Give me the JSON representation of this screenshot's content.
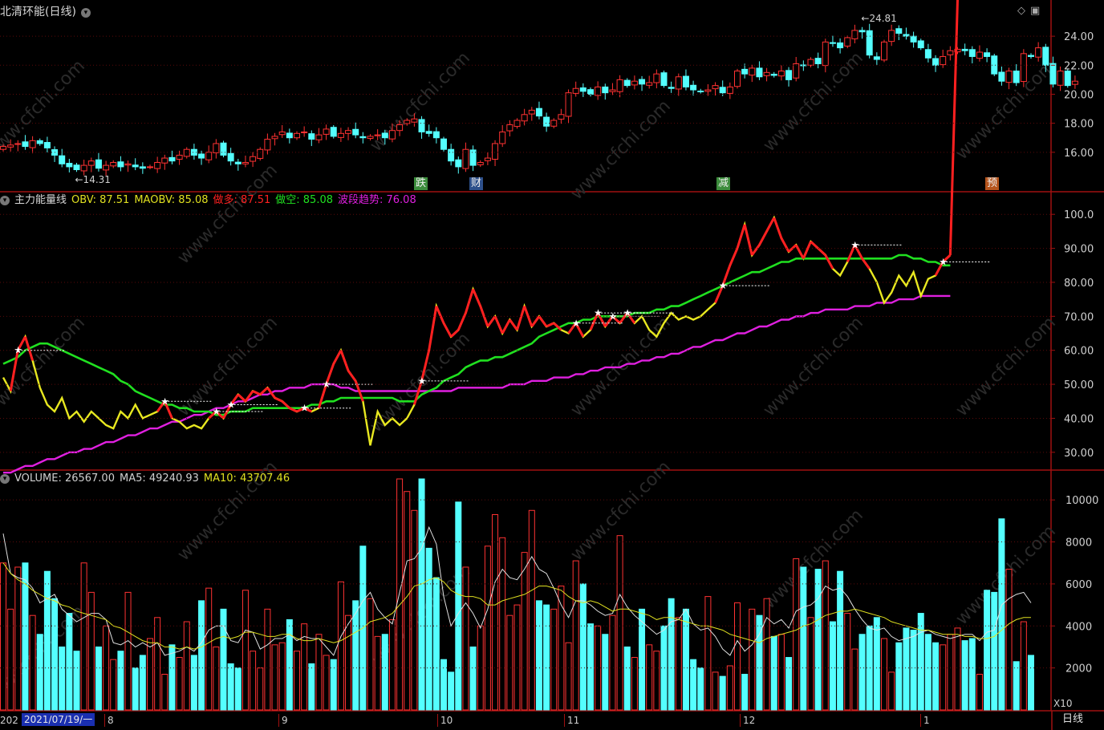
{
  "stock": {
    "title": "北清环能(日线)"
  },
  "price_axis": {
    "ticks": [
      "24.00",
      "22.00",
      "20.00",
      "18.00",
      "16.00"
    ]
  },
  "annotations": {
    "low_label": "14.31",
    "high_label": "24.81"
  },
  "event_tags": [
    {
      "label": "跌",
      "color": "#3c8c3c"
    },
    {
      "label": "财",
      "color": "#2d4f8a"
    },
    {
      "label": "减",
      "color": "#3c8c3c"
    },
    {
      "label": "预",
      "color": "#b5541c"
    }
  ],
  "indicator": {
    "name": "主力能量线",
    "fields": [
      {
        "text": "OBV: 87.51",
        "color": "#e0e020"
      },
      {
        "text": "MAOBV: 85.08",
        "color": "#e0e020"
      },
      {
        "text": "做多: 87.51",
        "color": "#ff2020"
      },
      {
        "text": "做空: 85.08",
        "color": "#20e020"
      },
      {
        "text": "波段趋势: 76.08",
        "color": "#e020e0"
      }
    ],
    "axis_ticks": [
      "100.0",
      "90.00",
      "80.00",
      "70.00",
      "60.00",
      "50.00",
      "40.00",
      "30.00"
    ]
  },
  "volume": {
    "fields": [
      {
        "text": "VOLUME: 26567.00",
        "color": "#d0d0d0"
      },
      {
        "text": "MA5: 49240.93",
        "color": "#d0d0d0"
      },
      {
        "text": "MA10: 43707.46",
        "color": "#e0e020"
      }
    ],
    "axis_ticks": [
      "10000",
      "8000",
      "6000",
      "4000",
      "2000"
    ],
    "unit": "X10"
  },
  "date_axis": {
    "current": "2021/07/19/一",
    "prefix": "202",
    "months": [
      "8",
      "9",
      "10",
      "11",
      "12",
      "1"
    ]
  },
  "period_button": "日线",
  "watermark": "www.cfchi.com",
  "chart_data": [
    {
      "type": "candlestick",
      "title": "北清环能(日线)",
      "ylim": [
        14.0,
        25.5
      ],
      "close": [
        16.4,
        16.5,
        16.6,
        16.4,
        16.8,
        16.6,
        16.3,
        15.8,
        15.2,
        15.0,
        14.8,
        15.1,
        15.4,
        14.9,
        15.1,
        15.3,
        15.0,
        15.2,
        15.0,
        14.9,
        15.0,
        15.3,
        15.6,
        15.4,
        15.8,
        16.2,
        15.8,
        15.6,
        16.0,
        16.6,
        15.8,
        15.4,
        15.2,
        15.3,
        15.7,
        16.2,
        16.9,
        17.1,
        17.4,
        17.0,
        17.3,
        17.4,
        16.9,
        17.2,
        17.6,
        17.1,
        17.3,
        17.5,
        17.2,
        17.0,
        17.1,
        17.2,
        17.0,
        17.5,
        17.9,
        18.2,
        18.3,
        17.4,
        17.3,
        17.0,
        16.2,
        15.4,
        15.0,
        16.2,
        15.1,
        15.3,
        15.6,
        16.6,
        17.4,
        17.9,
        18.2,
        18.6,
        18.9,
        18.5,
        17.8,
        18.2,
        18.6,
        20.1,
        20.4,
        20.2,
        20.0,
        20.5,
        20.1,
        20.3,
        21.0,
        20.6,
        20.9,
        20.7,
        20.8,
        21.4,
        20.6,
        20.4,
        21.2,
        20.5,
        20.3,
        20.2,
        20.3,
        20.6,
        20.1,
        20.5,
        21.6,
        21.4,
        21.8,
        21.2,
        21.5,
        21.3,
        21.6,
        21.0,
        22.1,
        22.0,
        22.4,
        22.1,
        23.6,
        23.5,
        23.2,
        23.9,
        24.4,
        24.3,
        22.7,
        22.4,
        23.6,
        24.4,
        24.2,
        24.0,
        23.6,
        23.2,
        22.5,
        22.0,
        22.6,
        23.0,
        23.1,
        23.0,
        22.6,
        22.9,
        22.6,
        21.4,
        20.9,
        21.6,
        20.8,
        22.8,
        22.6,
        23.2,
        22.0,
        20.7,
        21.6,
        20.6,
        20.9
      ]
    },
    {
      "type": "line",
      "title": "主力能量线",
      "ylim": [
        25,
        105
      ],
      "series": [
        {
          "name": "OBV",
          "values": [
            52,
            48,
            60,
            64,
            57,
            49,
            44,
            42,
            46,
            40,
            42,
            39,
            42,
            40,
            38,
            37,
            42,
            40,
            44,
            40,
            41,
            42,
            45,
            40,
            39,
            37,
            38,
            37,
            40,
            42,
            40,
            44,
            47,
            45,
            48,
            47,
            49,
            46,
            45,
            43,
            42,
            43,
            42,
            43,
            50,
            56,
            60,
            54,
            51,
            45,
            32,
            42,
            38,
            40,
            38,
            40,
            44,
            51,
            60,
            73,
            68,
            64,
            66,
            71,
            78,
            73,
            67,
            70,
            65,
            69,
            66,
            73,
            67,
            70,
            67,
            68,
            66,
            65,
            68,
            64,
            66,
            71,
            67,
            70,
            68,
            71,
            68,
            70,
            66,
            64,
            68,
            71,
            69,
            70,
            69,
            70,
            72,
            74,
            79,
            85,
            90,
            97,
            88,
            91,
            95,
            99,
            93,
            89,
            91,
            87,
            92,
            90,
            88,
            84,
            82,
            86,
            91,
            87,
            84,
            80,
            74,
            77,
            82,
            79,
            83,
            76,
            81,
            82,
            86,
            88
          ]
        },
        {
          "name": "MAOBV",
          "values": [
            56,
            57,
            58,
            60,
            61,
            62,
            62,
            61,
            60,
            59,
            58,
            57,
            56,
            55,
            54,
            53,
            51,
            50,
            48,
            47,
            46,
            45,
            44,
            44,
            43,
            43,
            42,
            42,
            42,
            41,
            41,
            42,
            42,
            42,
            43,
            43,
            43,
            43,
            43,
            43,
            43,
            43,
            44,
            44,
            45,
            45,
            46,
            46,
            46,
            46,
            46,
            46,
            46,
            46,
            45,
            45,
            45,
            47,
            48,
            49,
            51,
            52,
            53,
            55,
            56,
            57,
            57,
            58,
            58,
            59,
            60,
            61,
            62,
            64,
            65,
            66,
            67,
            68,
            68,
            69,
            69,
            70,
            70,
            70,
            70,
            70,
            71,
            71,
            71,
            72,
            72,
            73,
            73,
            74,
            75,
            76,
            77,
            78,
            79,
            80,
            81,
            82,
            83,
            83,
            84,
            85,
            86,
            86,
            87,
            87,
            87,
            87,
            87,
            87,
            87,
            87,
            87,
            87,
            87,
            87,
            87,
            87,
            88,
            88,
            87,
            87,
            86,
            86,
            85,
            85
          ]
        },
        {
          "name": "波段趋势",
          "values": [
            24,
            24,
            25,
            26,
            26,
            27,
            28,
            28,
            29,
            30,
            30,
            31,
            31,
            32,
            33,
            33,
            34,
            35,
            35,
            36,
            37,
            37,
            38,
            39,
            39,
            40,
            41,
            41,
            42,
            43,
            43,
            44,
            45,
            45,
            46,
            47,
            47,
            48,
            48,
            49,
            49,
            49,
            50,
            50,
            50,
            50,
            49,
            49,
            48,
            48,
            48,
            48,
            48,
            48,
            48,
            48,
            48,
            48,
            48,
            48,
            48,
            48,
            49,
            49,
            49,
            49,
            49,
            49,
            49,
            50,
            50,
            50,
            51,
            51,
            51,
            52,
            52,
            52,
            53,
            53,
            54,
            54,
            55,
            55,
            55,
            56,
            56,
            57,
            57,
            58,
            58,
            59,
            59,
            60,
            61,
            61,
            62,
            63,
            63,
            64,
            65,
            65,
            66,
            67,
            67,
            68,
            69,
            69,
            70,
            70,
            71,
            71,
            72,
            72,
            72,
            72,
            73,
            73,
            73,
            74,
            74,
            74,
            75,
            75,
            75,
            76,
            76,
            76,
            76,
            76
          ]
        }
      ]
    },
    {
      "type": "bar",
      "title": "VOLUME",
      "ylim": [
        0,
        11000
      ],
      "series": [
        {
          "name": "VOLUME",
          "values": [
            7000,
            4800,
            6800,
            7000,
            4500,
            3600,
            6600,
            5300,
            3000,
            4600,
            2800,
            7000,
            5600,
            3000,
            4000,
            2400,
            2800,
            5600,
            2000,
            2600,
            3400,
            4400,
            1700,
            3100,
            2500,
            4200,
            2600,
            5200,
            5800,
            3000,
            4800,
            2200,
            2000,
            5700,
            2800,
            2000,
            4800,
            3100,
            3200,
            4300,
            2800,
            4100,
            2200,
            3600,
            2600,
            2400,
            6100,
            4500,
            5200,
            7800,
            5300,
            3500,
            3600,
            4300,
            11000,
            10400,
            9500,
            11000,
            7700,
            6300,
            2400,
            1800,
            9900,
            6800,
            3000,
            4000,
            7800,
            9300,
            8200,
            4500,
            5000,
            7500,
            9500,
            5200,
            5000,
            4800,
            5900,
            3200,
            7100,
            6000,
            4100,
            4000,
            3600,
            4500,
            8300,
            3000,
            2500,
            4800,
            3100,
            2800,
            4000,
            5300,
            4400,
            4800,
            2400,
            2000,
            5400,
            1800,
            1600,
            2100,
            5100,
            1700,
            4800,
            4500,
            5300,
            3500,
            3600,
            2500,
            7200,
            6800,
            4400,
            6700,
            7100,
            4200,
            6600,
            4600,
            2900,
            3600,
            4000,
            4400,
            3400,
            1800,
            3200,
            3900,
            3800,
            4600,
            3600,
            3200,
            3100,
            3600,
            3900,
            3300,
            3400,
            1700,
            5700,
            5600,
            9100,
            6700,
            2300,
            4200,
            2600
          ]
        },
        {
          "name": "MA5",
          "values": [
            8400,
            6500,
            6300,
            6200,
            5800,
            5100,
            5300,
            5500,
            4800,
            4500,
            4200,
            4400,
            4600,
            4600,
            4300,
            3200,
            3100,
            3300,
            3000,
            3200,
            3000,
            3200,
            2600,
            2700,
            2800,
            3000,
            2800,
            3200,
            3800,
            4000,
            4000,
            3300,
            3200,
            3800,
            3700,
            2900,
            3100,
            3400,
            3400,
            3600,
            3300,
            3500,
            3400,
            3400,
            3000,
            2600,
            3500,
            4100,
            4600,
            5200,
            5600,
            4800,
            4400,
            4100,
            5600,
            7100,
            7200,
            7700,
            8700,
            7900,
            5400,
            4000,
            4600,
            5100,
            4600,
            3900,
            4800,
            6100,
            6700,
            6300,
            6200,
            6700,
            7300,
            6700,
            6500,
            5800,
            5000,
            4400,
            5200,
            5200,
            5000,
            4700,
            4500,
            4600,
            5500,
            4900,
            4500,
            4200,
            3900,
            3600,
            3800,
            4200,
            4300,
            4800,
            4100,
            3800,
            3900,
            3500,
            2900,
            2600,
            3300,
            2800,
            3100,
            3600,
            4400,
            4100,
            4300,
            3900,
            4700,
            4900,
            5000,
            5300,
            5900,
            5700,
            5800,
            5400,
            4800,
            4300,
            3900,
            3800,
            3900,
            3500,
            3300,
            3400,
            3500,
            3700,
            3800,
            3600,
            3500,
            3400,
            3500,
            3600,
            3600,
            3300,
            3700,
            3800,
            5000,
            5300,
            5500,
            5600,
            5100
          ]
        },
        {
          "name": "MA10",
          "values": [
            7000,
            6500,
            6200,
            6000,
            5700,
            5500,
            5300,
            5200,
            5000,
            4900,
            4700,
            4600,
            4500,
            4400,
            4300,
            4000,
            3900,
            3700,
            3500,
            3300,
            3200,
            3200,
            3000,
            3000,
            2900,
            3000,
            2900,
            3000,
            3200,
            3400,
            3500,
            3400,
            3500,
            3700,
            3700,
            3600,
            3500,
            3500,
            3600,
            3600,
            3400,
            3300,
            3300,
            3400,
            3300,
            3200,
            3300,
            3500,
            3700,
            3900,
            4200,
            4300,
            4400,
            4600,
            5000,
            5400,
            5900,
            6000,
            6200,
            6300,
            6100,
            5700,
            5500,
            5400,
            5400,
            5300,
            5000,
            5000,
            5200,
            5300,
            5400,
            5500,
            5700,
            5900,
            5900,
            5800,
            5700,
            5400,
            5200,
            5100,
            5200,
            5100,
            4900,
            4700,
            4800,
            4800,
            4700,
            4600,
            4500,
            4300,
            4400,
            4400,
            4300,
            4200,
            4100,
            4000,
            4000,
            3900,
            3800,
            3600,
            3500,
            3400,
            3300,
            3200,
            3400,
            3500,
            3600,
            3700,
            3800,
            4000,
            4100,
            4300,
            4500,
            4600,
            4700,
            4700,
            4800,
            4700,
            4600,
            4500,
            4400,
            4200,
            4100,
            4000,
            3900,
            3800,
            3800,
            3700,
            3600,
            3600,
            3600,
            3500,
            3500,
            3400,
            3400,
            3500,
            3800,
            4100,
            4300,
            4400,
            4400
          ]
        }
      ]
    }
  ]
}
